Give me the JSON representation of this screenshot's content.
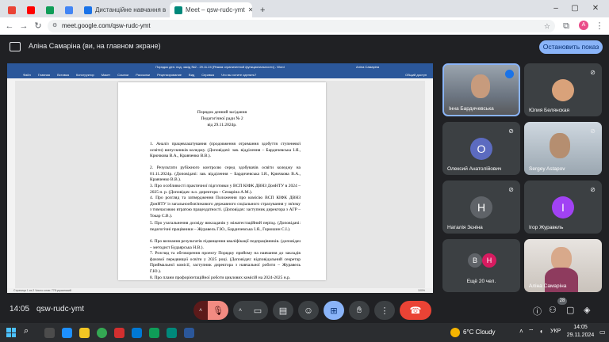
{
  "browser": {
    "tabs": [
      {
        "title": "Дистанційне навчання в ВСП",
        "active": false
      },
      {
        "title": "Meet – qsw-rudc-ymt",
        "active": true
      }
    ],
    "new_tab_symbol": "+",
    "url": "meet.google.com/qsw-rudc-ymt"
  },
  "meet": {
    "presenter_label": "Аліна Самаріна (ви, на главном экране)",
    "stop_sharing_label": "Остановить показ",
    "time": "14:05",
    "meeting_code": "qsw-rudc-ymt",
    "participants_count": "28",
    "participants": [
      {
        "name": "Інна Бардичевська",
        "type": "video",
        "muted": false,
        "speaking": true
      },
      {
        "name": "Юлия Белянская",
        "type": "avatar-photo",
        "muted": true
      },
      {
        "name": "Олексий Анатолійович",
        "type": "initial",
        "initial": "О",
        "color": "#5c6bc0",
        "muted": true
      },
      {
        "name": "Sergey Astapov",
        "type": "video",
        "muted": true
      },
      {
        "name": "Наталія Зєніна",
        "type": "initial",
        "initial": "Н",
        "color": "#5f6368",
        "muted": true
      },
      {
        "name": "Ігор Журавель",
        "type": "initial",
        "initial": "І",
        "color": "#a142f4",
        "muted": true
      },
      {
        "name": "Ещё 20 чел.",
        "type": "group",
        "initials": [
          "В",
          "Н"
        ],
        "colors": [
          "#5f6368",
          "#d81b60"
        ],
        "muted": false
      },
      {
        "name": "Аліна Самаріна",
        "type": "video",
        "muted": false
      }
    ]
  },
  "word": {
    "title": "Порядок ден. под. засід №2 - 29.11.24 [Режим ограниченной функциональности] - Word",
    "user": "Аліна Самаріна",
    "menu": [
      "Файл",
      "Главная",
      "Вставка",
      "Конструктор",
      "Макет",
      "Ссылки",
      "Рассылки",
      "Рецензирование",
      "Вид",
      "Справка",
      "Что вы хотите сделать?"
    ],
    "share": "Общий доступ",
    "status": "Страница 1 из 2   Число слов: 778   украинский",
    "zoom": "100%",
    "doc": {
      "heading": [
        "Порядок денний засідання",
        "Педагогічної ради № 2",
        "від 29.11.2024р."
      ],
      "items": [
        "1. Аналіз працевлаштування (продовження отримання здобуття ступеневої освіти) випускників коледжу. (Доповідачі: зав. відділення – Бардичевська І.Я., Крючкова В.А., Кравченко В.В.).",
        "2. Результати рубіжного контролю серед здобувачів освіти коледжу на 01.11.2024р. (Доповідачі: зав. відділення – Бардичевська І.Я., Крючкова В.А., Кравченко В.В.).",
        "3. Про особливості практичної підготовки у ВСП КІФК ДВНЗ ДонНТУ в 2024 – 2025 н. р. (Доповідач: в.о. директора – Семаріна А.М.).",
        "4. Про розгляд та затвердження Положення про комісію ВСП КІФК ДВНЗ ДонНТУ із загальнообов'язкового державного соціального страхування у зв'язку з тимчасовою втратою працездатності. (Доповідач: заступник директора з АГР – Токар С.В.).",
        "5. Про узагальнення досвіду викладачів у міжатестаційний період. (Доповідачі: педагогічні працівники – Журавель Г.Ю., Бардичевська І.Я., Горюшин С.І.).",
        "6. Про визнання результатів підвищення кваліфікації педпрацівників. (доповідач – методист Будаярська Н.В.).",
        "7. Розгляд та обговорення проекту Порядку прийому на навчання до закладів фахової передвищої освіти у 2025 році. (Доповідач: відповідальний секретар Приймальної комісії, заступник директора з навчальної роботи – Журавель Г.Ю.).",
        "8. Про плани профорієнтаційної роботи циклових комісій на 2024-2025 н.р."
      ]
    }
  },
  "taskbar": {
    "weather": "6°C  Cloudy",
    "lang": "УКР",
    "time": "14:05",
    "date": "29.11.2024"
  },
  "colors": {
    "meet_bg": "#202124",
    "accent_blue": "#8ab4f8",
    "hangup_red": "#ea4335",
    "word_blue": "#2b579a"
  }
}
